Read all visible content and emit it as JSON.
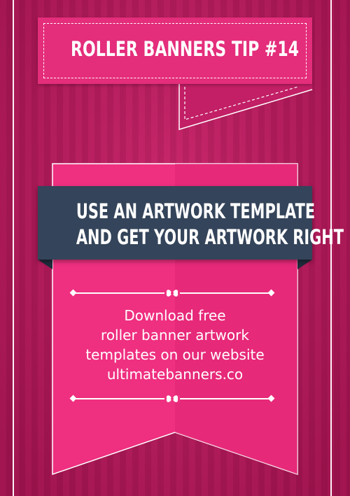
{
  "tip_banner": {
    "title": "ROLLER BANNERS TIP  #14"
  },
  "headline": {
    "line1": "USE AN ARTWORK TEMPLATE",
    "line2": "AND GET YOUR ARTWORK RIGHT"
  },
  "body": {
    "line1": "Download free",
    "line2": "roller banner artwork",
    "line3": "templates on our website",
    "line4": "ultimatebanners.co"
  },
  "colors": {
    "background": "#c51a62",
    "banner_pink": "#e42d7b",
    "ribbon_pink": "#ef2f80",
    "headline_band": "#34445a",
    "text": "#ffffff"
  },
  "icons": {
    "divider_ornament": "bow-icon"
  }
}
